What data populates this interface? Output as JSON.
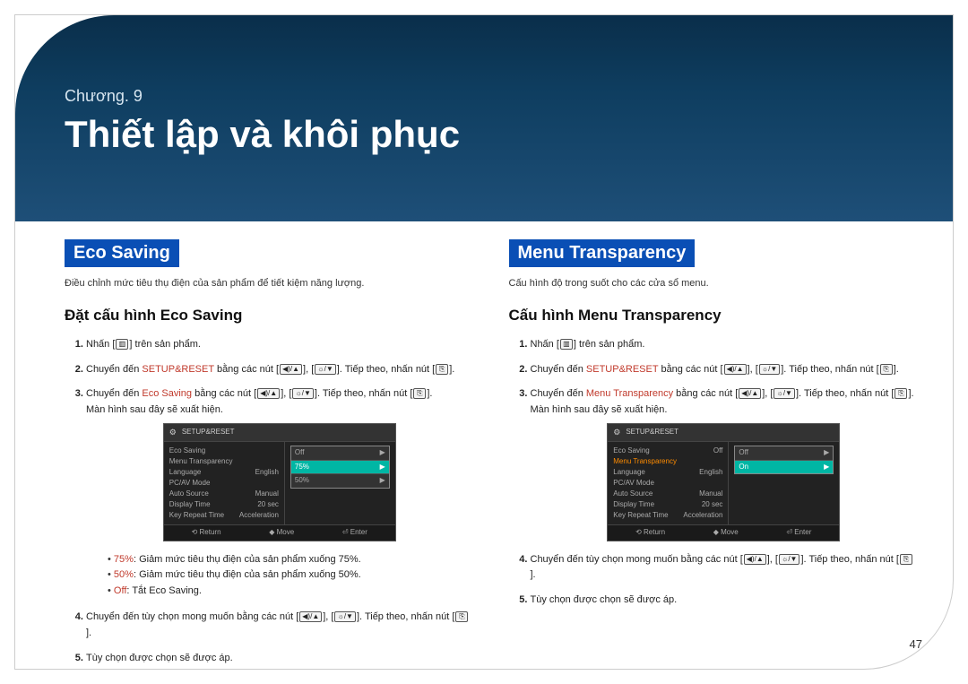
{
  "header": {
    "chapter_label": "Chương. 9",
    "chapter_title": "Thiết lập và khôi phục"
  },
  "page_number": "47",
  "left": {
    "title": "Eco Saving",
    "desc": "Điều chỉnh mức tiêu thụ điện của sản phẩm để tiết kiệm năng lượng.",
    "subtitle": "Đặt cấu hình Eco Saving",
    "step1_a": "Nhấn [",
    "step1_b": "] trên sản phẩm.",
    "step2_a": "Chuyển đến ",
    "step2_kw": "SETUP&RESET",
    "step2_b": " bằng các nút [",
    "step2_c": "], [",
    "step2_d": "]. Tiếp theo, nhấn nút [",
    "step2_e": "].",
    "step3_a": "Chuyển đến ",
    "step3_kw": "Eco Saving",
    "step3_b": " bằng các nút [",
    "step3_c": "], [",
    "step3_d": "]. Tiếp theo, nhấn nút [",
    "step3_e": "].",
    "step3_f": "Màn hình sau đây sẽ xuất hiện.",
    "bullets": {
      "b1_kw": "75%",
      "b1": ": Giảm mức tiêu thụ điện của sản phẩm xuống 75%.",
      "b2_kw": "50%",
      "b2": ": Giảm mức tiêu thụ điện của sản phẩm xuống 50%.",
      "b3_kw": "Off",
      "b3": ": Tắt Eco Saving."
    },
    "step4_a": "Chuyển đến tùy chọn mong muốn bằng các nút [",
    "step4_b": "], [",
    "step4_c": "]. Tiếp theo, nhấn nút [",
    "step4_d": "].",
    "step5": "Tùy chọn được chọn sẽ được áp.",
    "osd": {
      "title": "SETUP&RESET",
      "rows": [
        {
          "label": "Eco Saving",
          "value": ""
        },
        {
          "label": "Menu Transparency",
          "value": ""
        },
        {
          "label": "Language",
          "value": "English"
        },
        {
          "label": "PC/AV Mode",
          "value": ""
        },
        {
          "label": "Auto Source",
          "value": "Manual"
        },
        {
          "label": "Display Time",
          "value": "20 sec"
        },
        {
          "label": "Key Repeat Time",
          "value": "Acceleration"
        }
      ],
      "options": [
        {
          "label": "Off",
          "hi": false
        },
        {
          "label": "75%",
          "hi": true
        },
        {
          "label": "50%",
          "hi": false
        }
      ],
      "foot": {
        "a": "⟲ Return",
        "b": "◆ Move",
        "c": "⏎ Enter"
      }
    }
  },
  "right": {
    "title": "Menu Transparency",
    "desc": "Cấu hình độ trong suốt cho các cửa sổ menu.",
    "subtitle": "Cấu hình Menu Transparency",
    "step1_a": "Nhấn [",
    "step1_b": "] trên sản phẩm.",
    "step2_a": "Chuyển đến ",
    "step2_kw": "SETUP&RESET",
    "step2_b": " bằng các nút [",
    "step2_c": "], [",
    "step2_d": "]. Tiếp theo, nhấn nút [",
    "step2_e": "].",
    "step3_a": "Chuyển đến ",
    "step3_kw": "Menu Transparency",
    "step3_b": " bằng các nút [",
    "step3_c": "], [",
    "step3_d": "]. Tiếp theo, nhấn nút [",
    "step3_e": "].",
    "step3_f": "Màn hình sau đây sẽ xuất hiện.",
    "step4_a": "Chuyển đến tùy chọn mong muốn bằng các nút [",
    "step4_b": "], [",
    "step4_c": "]. Tiếp theo, nhấn nút [",
    "step4_d": "].",
    "step5": "Tùy chọn được chọn sẽ được áp.",
    "osd": {
      "title": "SETUP&RESET",
      "rows": [
        {
          "label": "Eco Saving",
          "value": "Off"
        },
        {
          "label": "Menu Transparency",
          "value": "",
          "sel": true
        },
        {
          "label": "Language",
          "value": "English"
        },
        {
          "label": "PC/AV Mode",
          "value": ""
        },
        {
          "label": "Auto Source",
          "value": "Manual"
        },
        {
          "label": "Display Time",
          "value": "20 sec"
        },
        {
          "label": "Key Repeat Time",
          "value": "Acceleration"
        }
      ],
      "options": [
        {
          "label": "Off",
          "hi": false
        },
        {
          "label": "On",
          "hi": true
        }
      ],
      "foot": {
        "a": "⟲ Return",
        "b": "◆ Move",
        "c": "⏎ Enter"
      }
    }
  },
  "icons": {
    "menu": "▥",
    "up": "◀)/▲",
    "down": "☼/▼",
    "enter": "⎘"
  }
}
